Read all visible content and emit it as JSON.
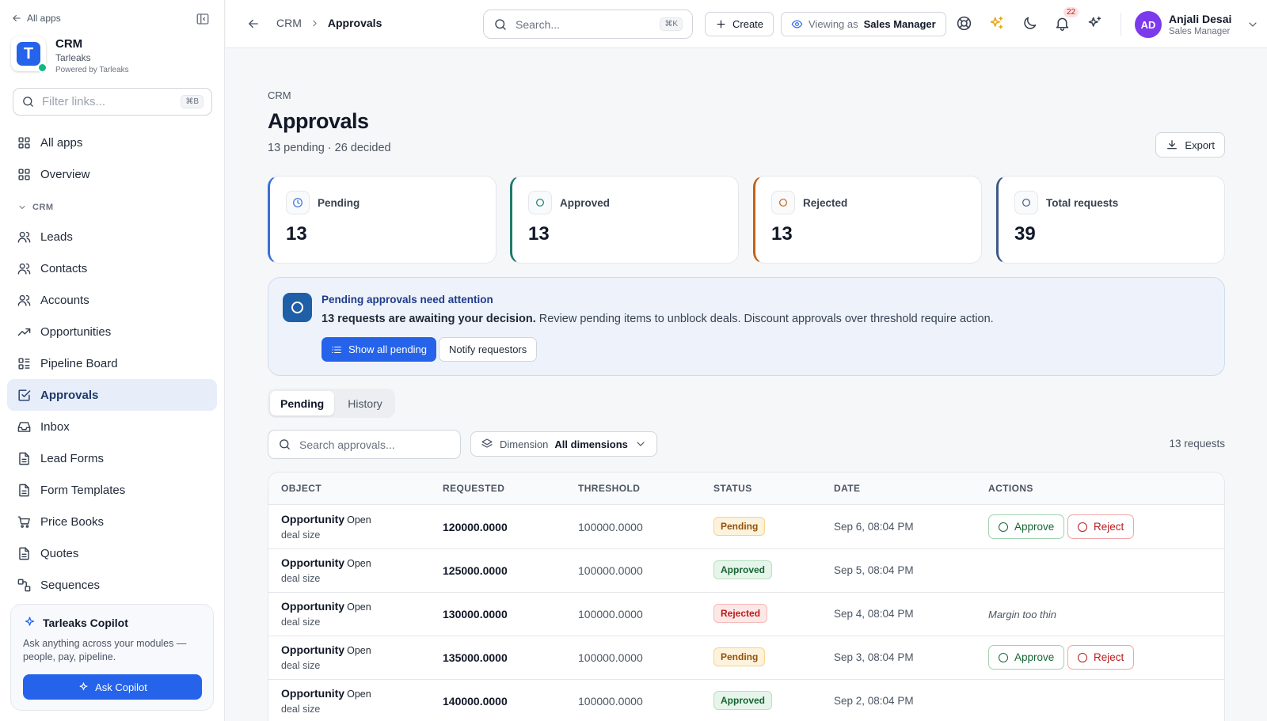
{
  "sidebar": {
    "back_label": "All apps",
    "app_name": "CRM",
    "org_name": "Tarleaks",
    "powered_by": "Powered by Tarleaks",
    "logo_letter": "T",
    "filter_placeholder": "Filter links...",
    "filter_shortcut": "⌘B",
    "top_items": [
      {
        "label": "All apps",
        "icon": "grid-icon"
      },
      {
        "label": "Overview",
        "icon": "grid-icon"
      }
    ],
    "section_label": "CRM",
    "items": [
      {
        "label": "Leads",
        "icon": "users-icon"
      },
      {
        "label": "Contacts",
        "icon": "users-icon"
      },
      {
        "label": "Accounts",
        "icon": "users-icon"
      },
      {
        "label": "Opportunities",
        "icon": "trending-up-icon"
      },
      {
        "label": "Pipeline Board",
        "icon": "kanban-icon"
      },
      {
        "label": "Approvals",
        "icon": "check-square-icon",
        "active": true
      },
      {
        "label": "Inbox",
        "icon": "inbox-icon"
      },
      {
        "label": "Lead Forms",
        "icon": "document-icon"
      },
      {
        "label": "Form Templates",
        "icon": "document-icon"
      },
      {
        "label": "Price Books",
        "icon": "cart-icon"
      },
      {
        "label": "Quotes",
        "icon": "document-icon"
      },
      {
        "label": "Sequences",
        "icon": "workflow-icon"
      }
    ],
    "copilot": {
      "title": "Tarleaks Copilot",
      "description": "Ask anything across your modules — people, pay, pipeline.",
      "button": "Ask Copilot"
    }
  },
  "topbar": {
    "breadcrumb": [
      "CRM",
      "Approvals"
    ],
    "search_placeholder": "Search...",
    "search_shortcut": "⌘K",
    "create_label": "Create",
    "viewing_as_label": "Viewing as",
    "viewing_as_value": "Sales Manager",
    "notification_count": "22",
    "user": {
      "initials": "AD",
      "name": "Anjali Desai",
      "role": "Sales Manager"
    }
  },
  "page": {
    "eyebrow": "CRM",
    "title": "Approvals",
    "subtitle": "13 pending · 26 decided",
    "export_label": "Export"
  },
  "stats": [
    {
      "label": "Pending",
      "value": "13",
      "color": "#3b6fd4",
      "icon": "clock-icon"
    },
    {
      "label": "Approved",
      "value": "13",
      "color": "#1f7a6a",
      "icon": "circle-icon"
    },
    {
      "label": "Rejected",
      "value": "13",
      "color": "#c2621a",
      "icon": "circle-icon"
    },
    {
      "label": "Total requests",
      "value": "39",
      "color": "#3b5a86",
      "icon": "circle-icon"
    }
  ],
  "alert": {
    "title": "Pending approvals need attention",
    "bold": "13 requests are awaiting your decision.",
    "text": " Review pending items to unblock deals. Discount approvals over threshold require action.",
    "primary_button": "Show all pending",
    "secondary_button": "Notify requestors"
  },
  "tabs": [
    "Pending",
    "History"
  ],
  "filters": {
    "search_placeholder": "Search approvals...",
    "dimension_label": "Dimension",
    "dimension_value": "All dimensions",
    "count": "13 requests"
  },
  "table": {
    "columns": [
      "OBJECT",
      "REQUESTED",
      "THRESHOLD",
      "STATUS",
      "DATE",
      "ACTIONS"
    ],
    "approve_label": "Approve",
    "reject_label": "Reject",
    "rows": [
      {
        "object": "Opportunity",
        "state": "Open",
        "detail": "deal size",
        "requested": "120000.0000",
        "threshold": "100000.0000",
        "status": "Pending",
        "date": "Sep 6, 08:04 PM",
        "note": ""
      },
      {
        "object": "Opportunity",
        "state": "Open",
        "detail": "deal size",
        "requested": "125000.0000",
        "threshold": "100000.0000",
        "status": "Approved",
        "date": "Sep 5, 08:04 PM",
        "note": ""
      },
      {
        "object": "Opportunity",
        "state": "Open",
        "detail": "deal size",
        "requested": "130000.0000",
        "threshold": "100000.0000",
        "status": "Rejected",
        "date": "Sep 4, 08:04 PM",
        "note": "Margin too thin"
      },
      {
        "object": "Opportunity",
        "state": "Open",
        "detail": "deal size",
        "requested": "135000.0000",
        "threshold": "100000.0000",
        "status": "Pending",
        "date": "Sep 3, 08:04 PM",
        "note": ""
      },
      {
        "object": "Opportunity",
        "state": "Open",
        "detail": "deal size",
        "requested": "140000.0000",
        "threshold": "100000.0000",
        "status": "Approved",
        "date": "Sep 2, 08:04 PM",
        "note": ""
      }
    ]
  }
}
